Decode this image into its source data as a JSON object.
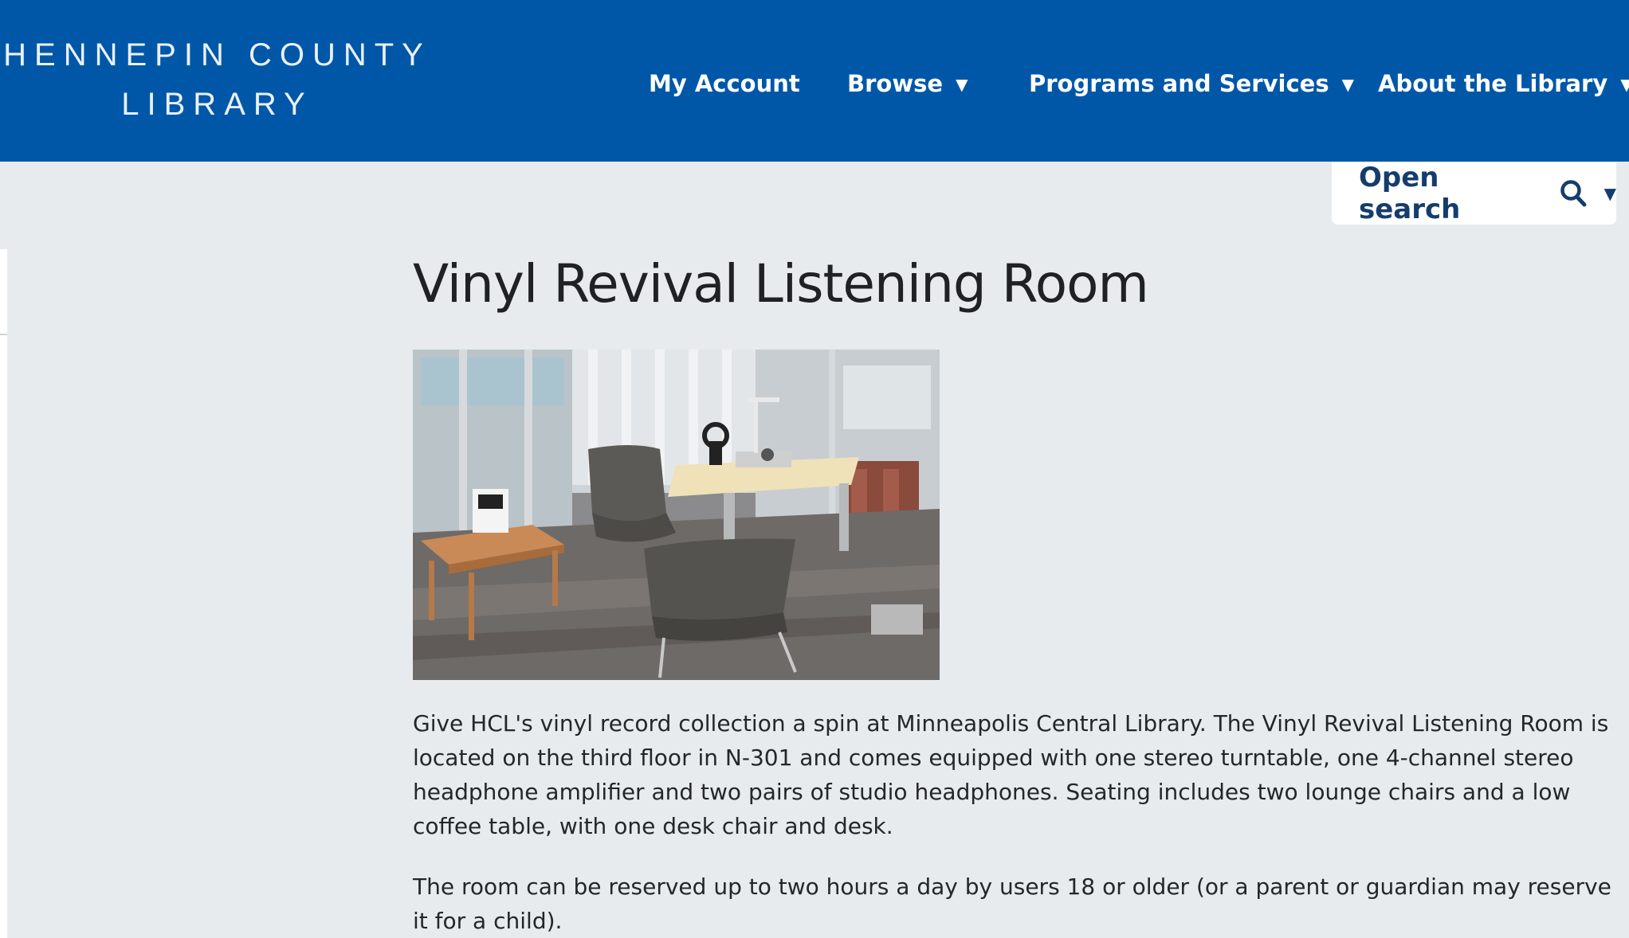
{
  "header": {
    "logo_line1": "HENNEPIN COUNTY",
    "logo_line2": "LIBRARY",
    "brand_color": "#0057a8"
  },
  "nav": {
    "my_account": "My Account",
    "browse": "Browse",
    "programs": "Programs and Services",
    "about": "About the Library",
    "caret": "▼"
  },
  "search": {
    "label": "Open search",
    "icon": "search-icon"
  },
  "main": {
    "title": "Vinyl Revival Listening Room",
    "image_icon": "listening-room-photo",
    "paragraphs": [
      "Give HCL's vinyl record collection a spin at Minneapolis Central Library. The Vinyl Revival Listening Room is located on the third floor in N-301 and comes equipped with one stereo turntable, one 4-channel stereo headphone amplifier and two pairs of studio headphones. Seating includes two lounge chairs and a low coffee table, with one desk chair and desk.",
      "The room can be reserved up to two hours a day by users 18 or older (or a parent or guardian may reserve it for a child)."
    ]
  }
}
